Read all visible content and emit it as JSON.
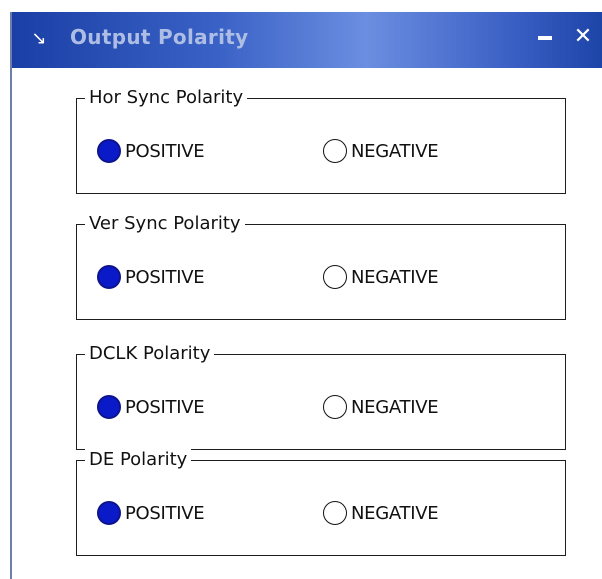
{
  "window": {
    "title": "Output Polarity",
    "icon": "arrow-down-icon",
    "minimize_glyph": "–",
    "close_glyph": "✕"
  },
  "groups": [
    {
      "label": "Hor Sync Polarity",
      "positive_label": "POSITIVE",
      "negative_label": "NEGATIVE",
      "selected": "POSITIVE"
    },
    {
      "label": "Ver Sync Polarity",
      "positive_label": "POSITIVE",
      "negative_label": "NEGATIVE",
      "selected": "POSITIVE"
    },
    {
      "label": "DCLK Polarity",
      "positive_label": "POSITIVE",
      "negative_label": "NEGATIVE",
      "selected": "POSITIVE"
    },
    {
      "label": "DE Polarity",
      "positive_label": "POSITIVE",
      "negative_label": "NEGATIVE",
      "selected": "POSITIVE"
    }
  ],
  "colors": {
    "titlebar": "#2f55be",
    "radio_selected": "#0a1ac8"
  }
}
